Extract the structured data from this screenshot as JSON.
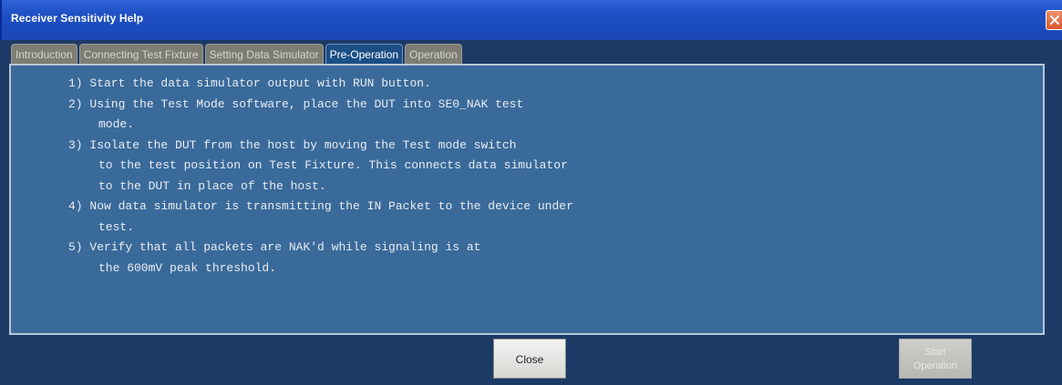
{
  "window": {
    "title": "Receiver Sensitivity Help"
  },
  "tabs": [
    {
      "label": "Introduction",
      "active": false
    },
    {
      "label": "Connecting Test Fixture",
      "active": false
    },
    {
      "label": "Setting Data Simulator",
      "active": false
    },
    {
      "label": "Pre-Operation",
      "active": true
    },
    {
      "label": "Operation",
      "active": false
    }
  ],
  "content": {
    "lines": [
      "1) Start the data simulator output with RUN button.",
      "2) Using the Test Mode software, place the DUT into SE0_NAK test",
      "mode.",
      "3) Isolate the DUT from the host by moving the Test mode switch",
      "to the test position on Test Fixture. This connects data simulator",
      "to the DUT in place of the host.",
      "4) Now data simulator is transmitting the IN Packet to the device under",
      "test.",
      "5) Verify that all packets are NAK'd while signaling is at",
      "the 600mV peak threshold."
    ]
  },
  "buttons": {
    "close_label": "Close",
    "start_line1": "Start",
    "start_line2": "Operation",
    "start_enabled": false
  },
  "colors": {
    "panel_bg": "#3a6a9a",
    "window_bg": "#1c3a66",
    "titlebar": "#1e4fc4",
    "active_tab": "#1c4f86",
    "inactive_tab": "#7d7d74",
    "close_x": "#d8542c"
  },
  "icons": {
    "title_close": "close-icon"
  }
}
